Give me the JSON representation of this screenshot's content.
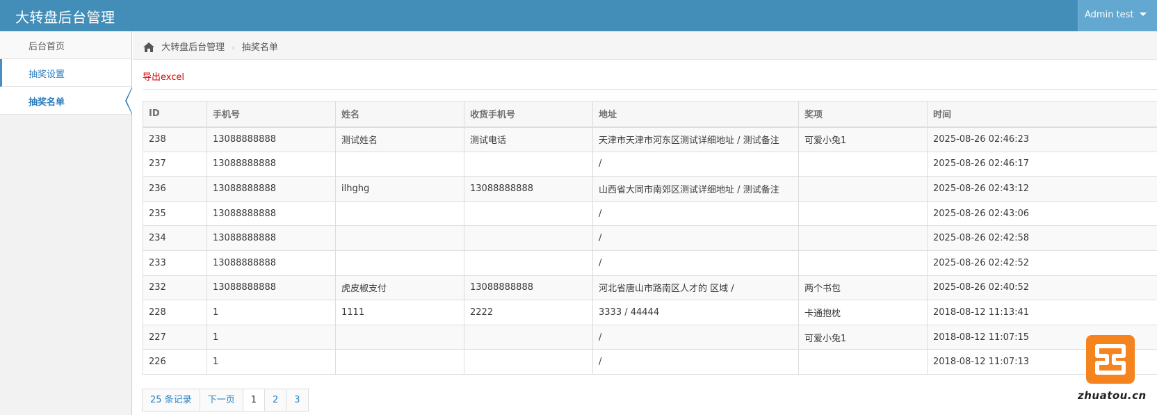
{
  "app": {
    "title": "大转盘后台管理"
  },
  "user": {
    "label": "Admin test"
  },
  "sidebar": {
    "items": [
      {
        "label": "后台首页"
      },
      {
        "label": "抽奖设置"
      },
      {
        "label": "抽奖名单"
      }
    ]
  },
  "breadcrumb": {
    "root": "大转盘后台管理",
    "current": "抽奖名单"
  },
  "actions": {
    "export": "导出excel"
  },
  "table": {
    "headers": [
      "ID",
      "手机号",
      "姓名",
      "收货手机号",
      "地址",
      "奖项",
      "时间"
    ],
    "rows": [
      [
        "238",
        "13088888888",
        "测试姓名",
        "测试电话",
        "天津市天津市河东区测试详细地址 / 测试备注",
        "可爱小兔1",
        "2025-08-26 02:46:23"
      ],
      [
        "237",
        "13088888888",
        "",
        "",
        "/",
        "",
        "2025-08-26 02:46:17"
      ],
      [
        "236",
        "13088888888",
        "ilhghg",
        "13088888888",
        "山西省大同市南郊区测试详细地址 / 测试备注",
        "",
        "2025-08-26 02:43:12"
      ],
      [
        "235",
        "13088888888",
        "",
        "",
        "/",
        "",
        "2025-08-26 02:43:06"
      ],
      [
        "234",
        "13088888888",
        "",
        "",
        "/",
        "",
        "2025-08-26 02:42:58"
      ],
      [
        "233",
        "13088888888",
        "",
        "",
        "/",
        "",
        "2025-08-26 02:42:52"
      ],
      [
        "232",
        "13088888888",
        "虎皮椒支付",
        "13088888888",
        "河北省唐山市路南区人才的 区域 /",
        "两个书包",
        "2025-08-26 02:40:52"
      ],
      [
        "228",
        "1",
        "1111",
        "2222",
        "3333 / 44444",
        "卡通抱枕",
        "2018-08-12 11:13:41"
      ],
      [
        "227",
        "1",
        "",
        "",
        "/",
        "可爱小兔1",
        "2018-08-12 11:07:15"
      ],
      [
        "226",
        "1",
        "",
        "",
        "/",
        "",
        "2018-08-12 11:07:13"
      ]
    ]
  },
  "pagination": {
    "total": "25 条记录",
    "next": "下一页",
    "pages": [
      "1",
      "2",
      "3"
    ],
    "current": "1"
  },
  "watermark": {
    "text": "zhuatou.cn"
  },
  "colors": {
    "topbar": "#438eb9",
    "link": "#2283c5",
    "export": "#dd0000",
    "watermark": "#f5841f"
  }
}
